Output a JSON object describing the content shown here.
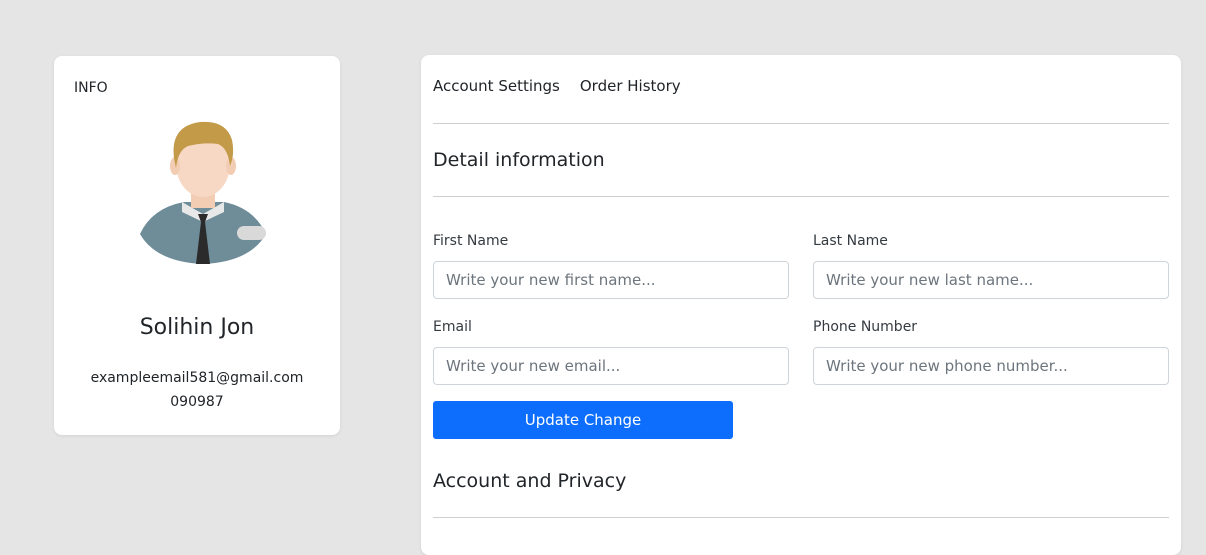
{
  "colors": {
    "background": "#e5e5e5",
    "card": "#ffffff",
    "primary_button": "#0d6efd"
  },
  "info_card": {
    "label": "INFO",
    "avatar_icon": "user-avatar-illustration",
    "name": "Solihin Jon",
    "email": "exampleemail581@gmail.com",
    "phone": "090987"
  },
  "settings": {
    "tabs": [
      {
        "label": "Account Settings"
      },
      {
        "label": "Order History"
      }
    ],
    "detail_title": "Detail information",
    "fields": {
      "first_name": {
        "label": "First Name",
        "placeholder": "Write your new first name...",
        "value": ""
      },
      "last_name": {
        "label": "Last Name",
        "placeholder": "Write your new last name...",
        "value": ""
      },
      "email": {
        "label": "Email",
        "placeholder": "Write your new email...",
        "value": ""
      },
      "phone": {
        "label": "Phone Number",
        "placeholder": "Write your new phone number...",
        "value": ""
      }
    },
    "update_button": "Update Change",
    "privacy_title": "Account and Privacy"
  }
}
